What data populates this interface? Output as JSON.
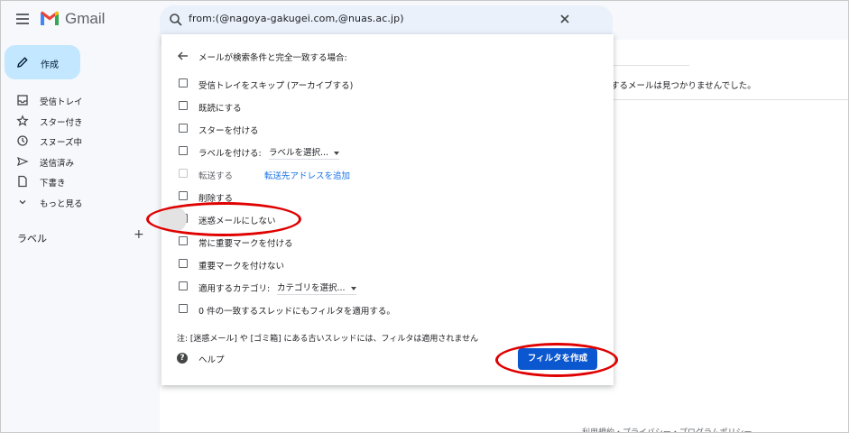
{
  "header": {
    "app_name": "Gmail",
    "search_query": "from:(@nagoya-gakugei.com,@nuas.ac.jp)"
  },
  "compose": {
    "label": "作成"
  },
  "sidebar": {
    "items": [
      {
        "label": "受信トレイ",
        "icon": "inbox-icon"
      },
      {
        "label": "スター付き",
        "icon": "star-icon"
      },
      {
        "label": "スヌーズ中",
        "icon": "clock-icon"
      },
      {
        "label": "送信済み",
        "icon": "send-icon"
      },
      {
        "label": "下書き",
        "icon": "draft-icon"
      },
      {
        "label": "もっと見る",
        "icon": "chevron-down-icon"
      }
    ],
    "labels_heading": "ラベル",
    "labels_add": "+"
  },
  "main": {
    "no_result_text": "するメールは見つかりませんでした。",
    "footer_text": "利用規約・プライバシー・プログラムポリシー"
  },
  "filter_dialog": {
    "heading": "メールが検索条件と完全一致する場合:",
    "options": [
      {
        "label": "受信トレイをスキップ (アーカイブする)",
        "checked": false
      },
      {
        "label": "既読にする",
        "checked": false
      },
      {
        "label": "スターを付ける",
        "checked": false
      },
      {
        "label": "ラベルを付ける:",
        "select": "ラベルを選択...",
        "checked": false
      },
      {
        "label": "転送する",
        "link": "転送先アドレスを追加",
        "checked": false,
        "disabled": true
      },
      {
        "label": "削除する",
        "checked": false
      },
      {
        "label": "迷惑メールにしない",
        "checked": true
      },
      {
        "label": "常に重要マークを付ける",
        "checked": false
      },
      {
        "label": "重要マークを付けない",
        "checked": false
      },
      {
        "label": "適用するカテゴリ:",
        "select": "カテゴリを選択...",
        "checked": false
      },
      {
        "label": "0 件の一致するスレッドにもフィルタを適用する。",
        "checked": false
      }
    ],
    "note": "注: [迷惑メール] や [ゴミ箱] にある古いスレッドには、フィルタは適用されません",
    "help_label": "ヘルプ",
    "create_button": "フィルタを作成"
  },
  "colors": {
    "accent": "#0b57d0",
    "compose_bg": "#c2e7ff",
    "search_bg": "#eaf1fb",
    "annotation": "#e00000"
  }
}
